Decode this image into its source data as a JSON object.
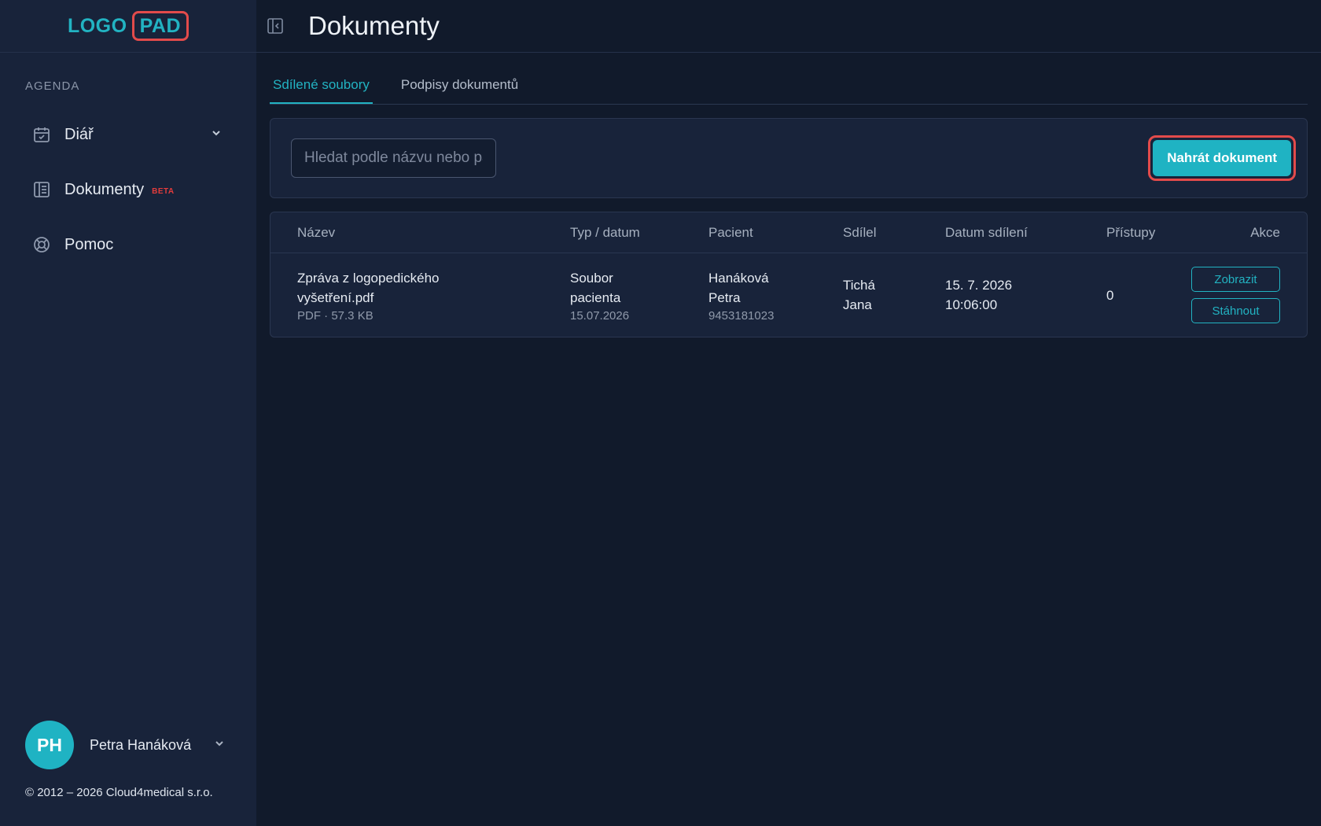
{
  "sidebar": {
    "logo_left": "LOGO",
    "logo_right": "PAD",
    "section_label": "AGENDA",
    "items": [
      {
        "label": "Diář",
        "icon": "calendar-check-icon",
        "has_chevron": true
      },
      {
        "label": "Dokumenty",
        "icon": "document-icon",
        "badge": "BETA"
      },
      {
        "label": "Pomoc",
        "icon": "lifebuoy-icon"
      }
    ],
    "user": {
      "initials": "PH",
      "name": "Petra Hanáková"
    },
    "copyright": "© 2012 – 2026 Cloud4medical s.r.o."
  },
  "header": {
    "title": "Dokumenty"
  },
  "tabs": [
    {
      "label": "Sdílené soubory",
      "active": true
    },
    {
      "label": "Podpisy dokumentů",
      "active": false
    }
  ],
  "toolbar": {
    "search_placeholder": "Hledat podle názvu nebo pacienta",
    "upload_label": "Nahrát dokument"
  },
  "table": {
    "columns": [
      "Název",
      "Typ / datum",
      "Pacient",
      "Sdílel",
      "Datum sdílení",
      "Přístupy",
      "Akce"
    ],
    "rows": [
      {
        "name_line1": "Zpráva z logopedického",
        "name_line2": "vyšetření.pdf",
        "name_meta": "PDF · 57.3 KB",
        "type_line1": "Soubor",
        "type_line2": "pacienta",
        "type_date": "15.07.2026",
        "patient_line1": "Hanáková",
        "patient_line2": "Petra",
        "patient_id": "9453181023",
        "shared_by_line1": "Tichá",
        "shared_by_line2": "Jana",
        "shared_date": "15. 7. 2026",
        "shared_time": "10:06:00",
        "accesses": "0",
        "action_view": "Zobrazit",
        "action_download": "Stáhnout"
      }
    ]
  },
  "colors": {
    "accent": "#1fb3c3",
    "background": "#111a2b",
    "sidebar": "#18233a",
    "highlight": "#e24b4b",
    "beta": "#e33c3c"
  }
}
